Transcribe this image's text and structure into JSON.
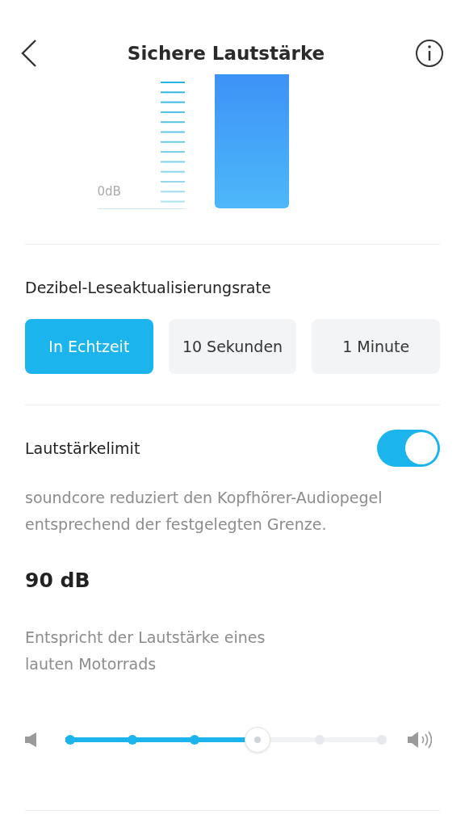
{
  "header": {
    "title": "Sichere Lautstärke"
  },
  "meter": {
    "label": "0dB"
  },
  "rate": {
    "title": "Dezibel-Leseaktualisierungsrate",
    "options": [
      {
        "label": "In Echtzeit",
        "selected": true
      },
      {
        "label": "10 Sekunden",
        "selected": false
      },
      {
        "label": "1 Minute",
        "selected": false
      }
    ]
  },
  "limit": {
    "title": "Lautstärkelimit",
    "on": true,
    "description": "soundcore reduziert den Kopfhörer-Audiopegel entsprechend der festgelegten Grenze.",
    "value": "90 dB",
    "comparison": "Entspricht der Lautstärke eines lauten Motorrads",
    "level": 0.6
  }
}
